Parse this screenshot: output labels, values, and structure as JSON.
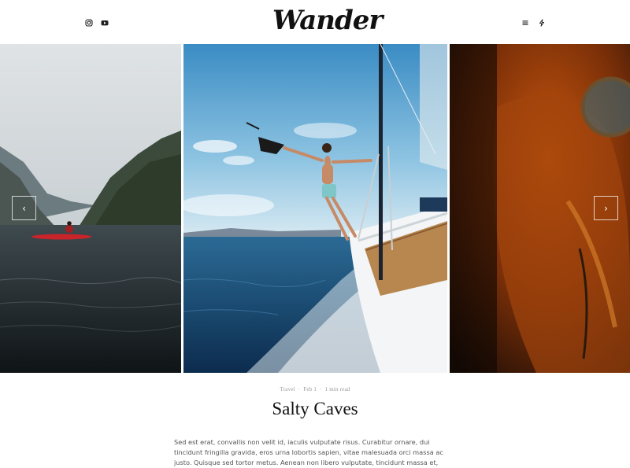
{
  "header": {
    "logo_text": "Wander",
    "social_icons": [
      "instagram-icon",
      "youtube-icon"
    ],
    "tool_icons": [
      "menu-icon",
      "lightning-icon"
    ]
  },
  "slider": {
    "slides": [
      {
        "name": "kayak-fjord-image"
      },
      {
        "name": "sailboat-man-image"
      },
      {
        "name": "orange-jacket-image"
      }
    ],
    "prev_arrow": "‹",
    "next_arrow": "›"
  },
  "post": {
    "category": "Travel",
    "date": "Feb 1",
    "read_time": "1 min read",
    "separator": "·",
    "title": "Salty Caves",
    "excerpt": "Sed est erat, convallis non velit id, iaculis vulputate risus. Curabitur ornare, dui tincidunt fringilla gravida, eros urna lobortis sapien, vitae malesuada orci massa ac justo. Quisque sed tortor metus. Aenean non libero vulputate, tincidunt massa et, auctor dui. Fusce ac sollicitudin magna. Curabitur"
  },
  "colors": {
    "accent": "#111111",
    "kayak": "#c8242a",
    "sea": "#1d4e7a",
    "jacket": "#c8560e"
  }
}
